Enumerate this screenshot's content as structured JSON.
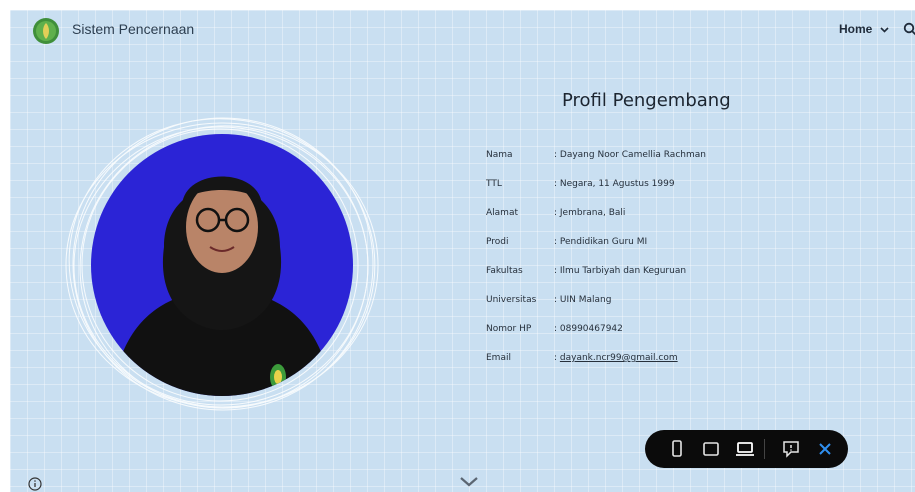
{
  "header": {
    "site_title": "Sistem Pencernaan",
    "nav_home_label": "Home",
    "icons": {
      "logo": "leaf-badge-logo",
      "search": "search-icon",
      "home_dropdown": "chevron-down-icon"
    }
  },
  "profile": {
    "heading": "Profil Pengembang",
    "rows": [
      {
        "key": "Nama",
        "value": ": Dayang Noor Camellia Rachman"
      },
      {
        "key": "TTL",
        "value": ": Negara, 11 Agustus 1999"
      },
      {
        "key": "Alamat",
        "value": ": Jembrana, Bali"
      },
      {
        "key": "Prodi",
        "value": ": Pendidikan Guru MI"
      },
      {
        "key": "Fakultas",
        "value": ": Ilmu Tarbiyah dan Keguruan"
      },
      {
        "key": "Universitas",
        "value": ": UIN Malang"
      },
      {
        "key": "Nomor HP",
        "value": ": 08990467942"
      },
      {
        "key": "Email",
        "value_prefix": ": ",
        "email": "dayank.ncr99@gmail.com"
      }
    ]
  },
  "toolbar": {
    "icons": [
      "mobile-view-icon",
      "tablet-view-icon",
      "desktop-view-icon",
      "feedback-icon",
      "close-icon"
    ]
  },
  "footer": {
    "icons": [
      "info-icon",
      "scroll-down-chevron-icon"
    ]
  },
  "colors": {
    "background": "#c9dff1",
    "photo_backdrop": "#2b24d6",
    "toolbar_bg": "#0b0b0b",
    "close_accent": "#2f8ff0",
    "logo_green": "#3f8f3a"
  }
}
